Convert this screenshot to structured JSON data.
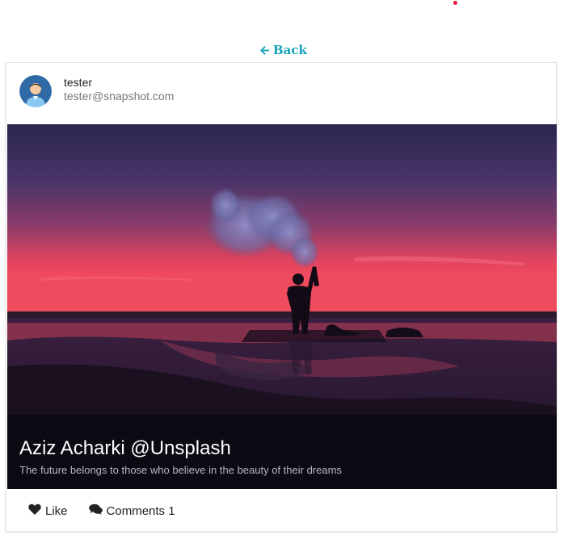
{
  "nav": {
    "back_label": "Back"
  },
  "post": {
    "user": {
      "name": "tester",
      "email": "tester@snapshot.com"
    },
    "image": {
      "title": "Aziz Acharki @Unsplash",
      "description": "The future belongs to those who believe in the beauty of their dreams"
    },
    "actions": {
      "like_label": "Like",
      "comments_label": "Comments 1"
    }
  },
  "colors": {
    "accent": "#17a2b8",
    "notification_dot": "#e8183a"
  },
  "icons": [
    "arrow-left-icon",
    "user-avatar-icon",
    "heart-icon",
    "comments-icon"
  ]
}
